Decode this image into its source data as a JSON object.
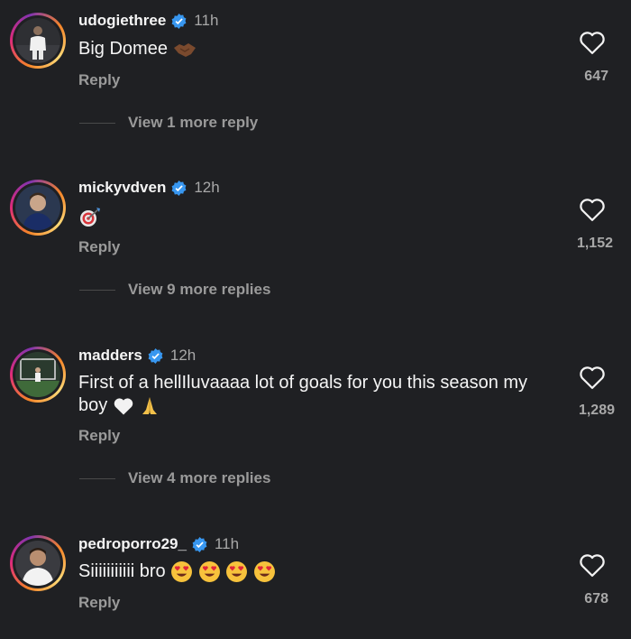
{
  "comments": [
    {
      "username": "udogiethree",
      "time": "11h",
      "text": "Big Domee",
      "emoji": "handshake",
      "reply_label": "Reply",
      "likes": "647",
      "more_replies": "View 1 more reply"
    },
    {
      "username": "mickyvdven",
      "time": "12h",
      "text": "",
      "emoji": "direct-hit",
      "reply_label": "Reply",
      "likes": "1,152",
      "more_replies": "View 9 more replies"
    },
    {
      "username": "madders",
      "time": "12h",
      "text": "First of a hellIluvaaaa lot of goals for you this season my boy",
      "emoji": "white-heart + folded-hands",
      "reply_label": "Reply",
      "likes": "1,289",
      "more_replies": "View 4 more replies"
    },
    {
      "username": "pedroporro29_",
      "time": "11h",
      "text": "Siiiiiiiiiii bro",
      "emoji": "heart-eyes x4",
      "reply_label": "Reply",
      "likes": "678"
    }
  ],
  "colors": {
    "background": "#1f2023",
    "verified": "#3897f0",
    "muted": "#a8a8a8"
  },
  "icons": [
    "verified-badge-icon",
    "heart-outline-icon"
  ]
}
